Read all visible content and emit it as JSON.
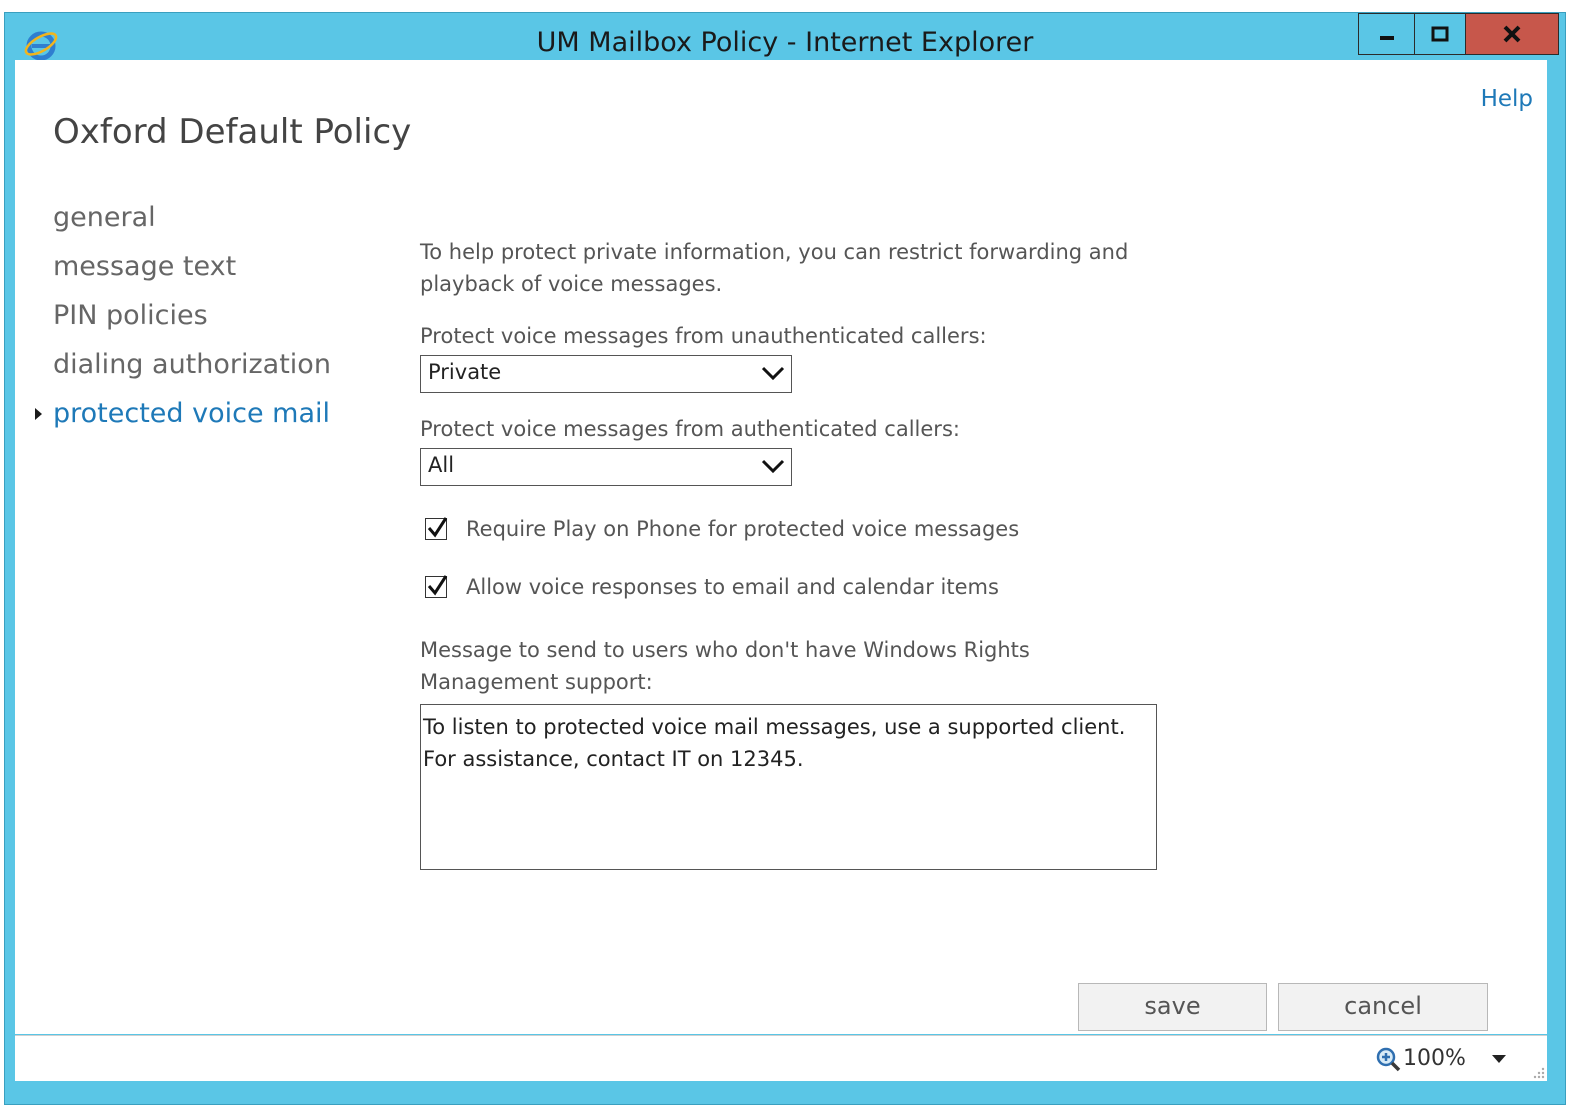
{
  "window": {
    "title": "UM Mailbox Policy - Internet Explorer",
    "icon": "internet-explorer-icon",
    "controls": [
      "minimize-icon",
      "maximize-icon",
      "close-icon"
    ]
  },
  "header": {
    "help_link": "Help",
    "policy_title": "Oxford Default Policy"
  },
  "nav": {
    "items": [
      {
        "label": "general",
        "active": false
      },
      {
        "label": "message text",
        "active": false
      },
      {
        "label": "PIN policies",
        "active": false
      },
      {
        "label": "dialing authorization",
        "active": false
      },
      {
        "label": "protected voice mail",
        "active": true
      }
    ]
  },
  "form": {
    "intro": "To help protect private information, you can restrict forwarding and playback of voice messages.",
    "unauth_label": "Protect voice messages from unauthenticated callers:",
    "unauth_value": "Private",
    "auth_label": "Protect voice messages from authenticated callers:",
    "auth_value": "All",
    "checkbox_play_on_phone": {
      "label": "Require Play on Phone for protected voice messages",
      "checked": true
    },
    "checkbox_voice_responses": {
      "label": "Allow voice responses to email and calendar items",
      "checked": true
    },
    "message_label": "Message to send to users who don't have Windows Rights Management support:",
    "message_value": "To listen to protected voice mail messages, use a supported client. For assistance, contact IT on 12345."
  },
  "actions": {
    "save_label": "save",
    "cancel_label": "cancel"
  },
  "statusbar": {
    "zoom_level": "100%"
  },
  "colors": {
    "titlebar": "#5ac6e6",
    "close_button": "#c7574b",
    "link_accent": "#1e79b8"
  }
}
